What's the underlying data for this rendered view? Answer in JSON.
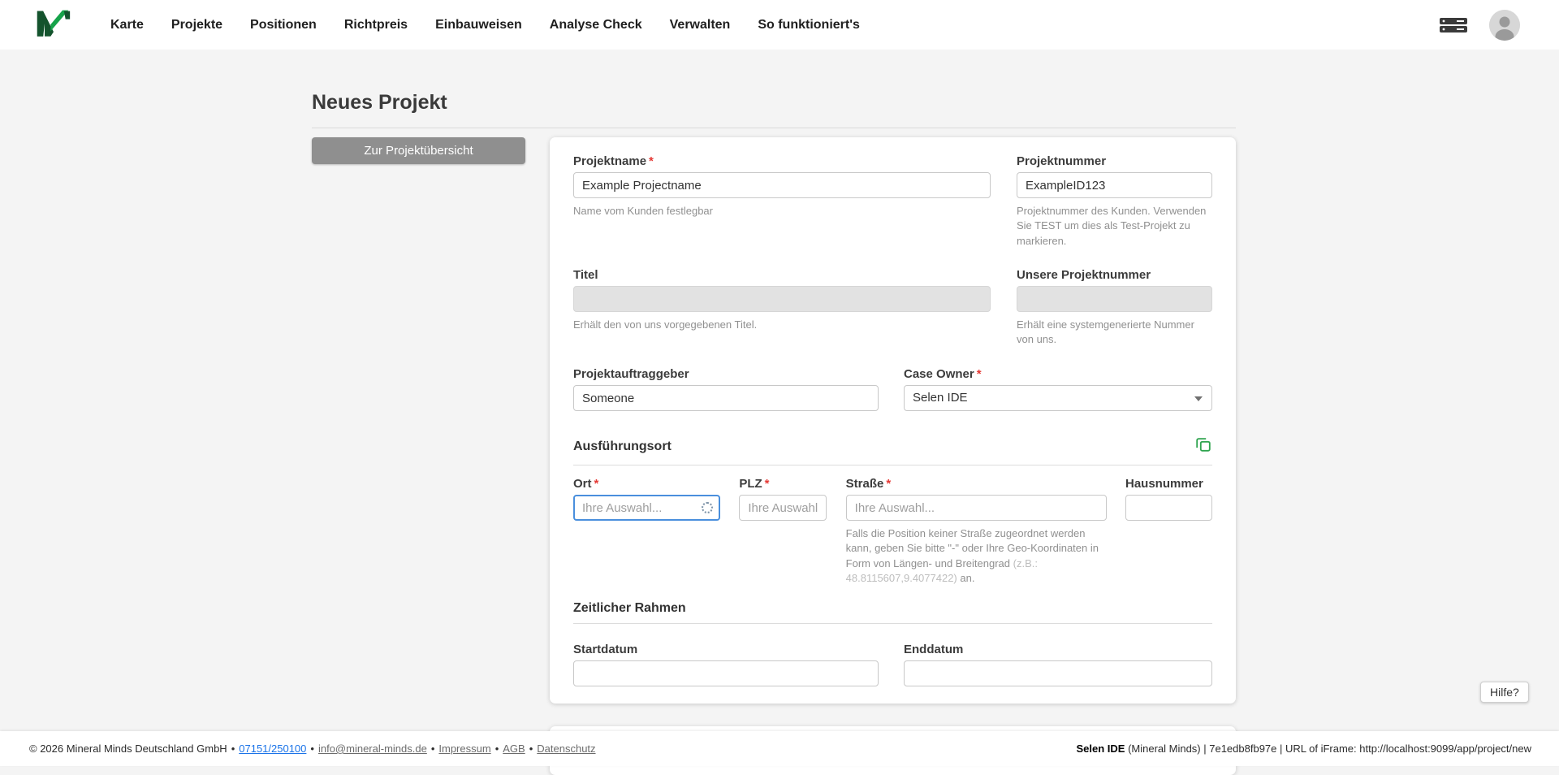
{
  "navbar": {
    "items": [
      {
        "label": "Karte"
      },
      {
        "label": "Projekte"
      },
      {
        "label": "Positionen"
      },
      {
        "label": "Richtpreis"
      },
      {
        "label": "Einbauweisen"
      },
      {
        "label": "Analyse Check"
      },
      {
        "label": "Verwalten"
      },
      {
        "label": "So funktioniert's"
      }
    ]
  },
  "page": {
    "title": "Neues Projekt",
    "back_button": "Zur Projektübersicht"
  },
  "form": {
    "projektname": {
      "label": "Projektname",
      "required": "*",
      "value": "Example Projectname",
      "helper": "Name vom Kunden festlegbar"
    },
    "projektnummer": {
      "label": "Projektnummer",
      "value": "ExampleID123",
      "helper": "Projektnummer des Kunden. Verwenden Sie TEST um dies als Test-Projekt zu markieren."
    },
    "titel": {
      "label": "Titel",
      "helper": "Erhält den von uns vorgegebenen Titel."
    },
    "unsere_projektnummer": {
      "label": "Unsere Projektnummer",
      "helper": "Erhält eine systemgenerierte Nummer von uns."
    },
    "projektauftraggeber": {
      "label": "Projektauftraggeber",
      "value": "Someone"
    },
    "case_owner": {
      "label": "Case Owner",
      "required": "*",
      "value": "Selen IDE"
    },
    "ausfuehrungsort": {
      "heading": "Ausführungsort"
    },
    "ort": {
      "label": "Ort",
      "required": "*",
      "placeholder": "Ihre Auswahl..."
    },
    "plz": {
      "label": "PLZ",
      "required": "*",
      "placeholder": "Ihre Auswahl."
    },
    "strasse": {
      "label": "Straße",
      "required": "*",
      "placeholder": "Ihre Auswahl...",
      "helper_main": "Falls die Position keiner Straße zugeordnet werden kann, geben Sie bitte \"-\" oder Ihre Geo-Koordinaten in Form von Längen- und Breitengrad ",
      "helper_example": "(z.B.: 48.8115607,9.4077422)",
      "helper_suffix": " an."
    },
    "hausnummer": {
      "label": "Hausnummer"
    },
    "zeitlicher_rahmen": {
      "heading": "Zeitlicher Rahmen"
    },
    "startdatum": {
      "label": "Startdatum"
    },
    "enddatum": {
      "label": "Enddatum"
    }
  },
  "help": {
    "label": "Hilfe?"
  },
  "footer": {
    "copyright": "© 2026 Mineral Minds Deutschland GmbH",
    "separator": "•",
    "phone": "07151/250100",
    "email": "info@mineral-minds.de",
    "links": [
      "Impressum",
      "AGB",
      "Datenschutz"
    ],
    "right_bold": "Selen IDE",
    "right_rest": " (Mineral Minds) | 7e1edb8fb97e | URL of iFrame: http://localhost:9099/app/project/new"
  },
  "icons": {
    "brand": "mineral-minds-logo",
    "server": "server-icon",
    "avatar": "user-avatar",
    "copy": "copy-icon",
    "spinner": "loading-spinner",
    "caret": "chevron-down"
  },
  "colors": {
    "accent_green": "#2fa44f",
    "logo_dark_green": "#14532d",
    "required_red": "#e53935",
    "focus_blue": "#4a8fdd",
    "button_gray": "#8f8f8f",
    "link_blue": "#1a73e8",
    "background": "#f4f4f4"
  }
}
